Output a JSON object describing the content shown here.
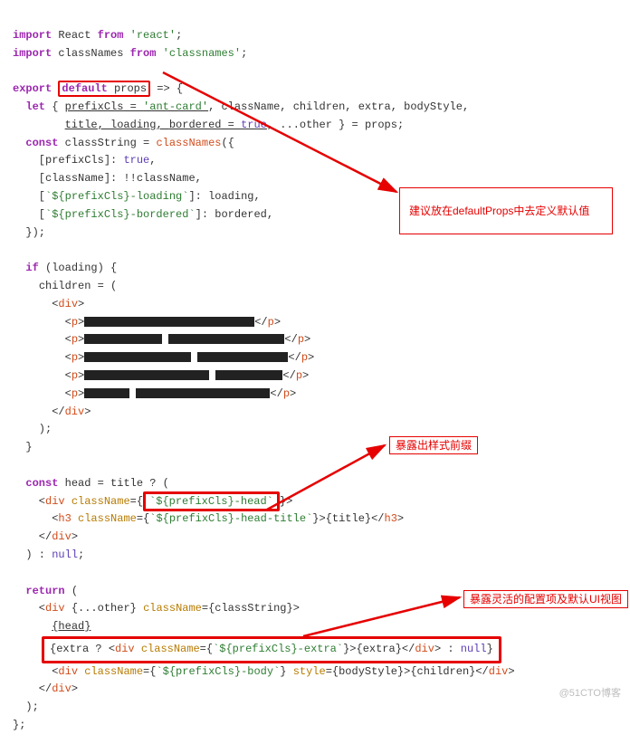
{
  "lines": {
    "l1_import": "import",
    "l1_React": "React",
    "l1_from": "from",
    "l1_react_str": "'react'",
    "l2_import": "import",
    "l2_classNames": "classNames",
    "l2_from": "from",
    "l2_cn_str": "'classnames'",
    "exp_export": "export",
    "exp_default": "default",
    "exp_props": "props",
    "let": "let",
    "prefixCls": "prefixCls",
    "antcard": "'ant-card'",
    "className": "className",
    "children": "children",
    "extra": "extra",
    "bodyStyle": "bodyStyle",
    "title": "title",
    "loading": "loading",
    "bordered": "bordered",
    "true": "true",
    "other": "other",
    "propsEnd": "props",
    "const1": "const",
    "classString": "classString",
    "classNamesFn": "classNames",
    "prefixClsKey": "prefixCls",
    "classNameKey": "className",
    "classNameVal": "className",
    "loadingTpl": "`${prefixCls}-loading`",
    "borderedTpl": "`${prefixCls}-bordered`",
    "loadingVal": "loading",
    "borderedVal": "bordered",
    "if": "if",
    "loadingIf": "loading",
    "childrenAssign": "children",
    "div": "div",
    "p": "p",
    "const2": "const",
    "head": "head",
    "titleTernary": "title",
    "headTpl1": "`",
    "headTplMid": "${prefixCls}-head",
    "headTpl2": "`",
    "h3": "h3",
    "headTitleTpl": "`${prefixCls}-head-title`",
    "titleOut": "title",
    "null1": "null",
    "return": "return",
    "otherSpread": "other",
    "classStringRef": "classString",
    "headOut": "head",
    "extraTernary": "extra",
    "extraTpl": "`${prefixCls}-extra`",
    "extraOut": "extra",
    "null2": "null",
    "bodyTpl": "`${prefixCls}-body`",
    "style": "style",
    "bodyStyleRef": "bodyStyle",
    "childrenOut": "children"
  },
  "annotations": {
    "a1": "建议放在defaultProps中去定义默认值",
    "a2": "暴露出样式前缀",
    "a3": "暴露灵活的配置项及默认UI视图"
  },
  "watermark": "@51CTO博客"
}
